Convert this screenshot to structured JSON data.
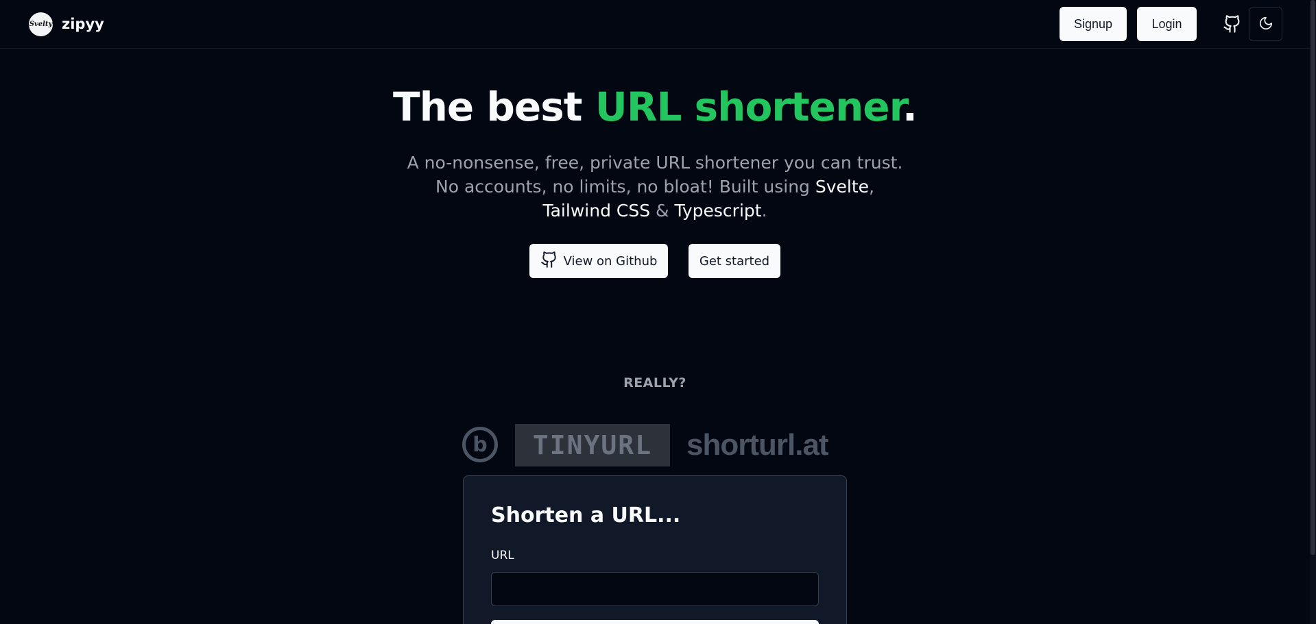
{
  "header": {
    "brand_name": "zipyy",
    "logo_text": "Svelty",
    "signup_label": "Signup",
    "login_label": "Login"
  },
  "hero": {
    "title_prefix": "The best ",
    "title_accent": "URL shortener",
    "title_suffix": ".",
    "subtitle_part1": "A no-nonsense, free, private URL shortener you can trust. No accounts, no limits, no bloat! Built using ",
    "tech1": "Svelte",
    "sep1": ", ",
    "tech2": "Tailwind CSS",
    "sep2": " & ",
    "tech3": "Typescript",
    "subtitle_end": ".",
    "github_button_label": "View on Github",
    "get_started_label": "Get started"
  },
  "comparison": {
    "heading": "REALLY?",
    "logo_tinyurl": "TINYURL",
    "logo_shorturl": "shorturl.at",
    "logo_bitly": "b"
  },
  "form": {
    "title": "Shorten a URL...",
    "url_label": "URL",
    "url_value": ""
  },
  "colors": {
    "background": "#030712",
    "accent": "#22c55e",
    "card": "#111827"
  }
}
